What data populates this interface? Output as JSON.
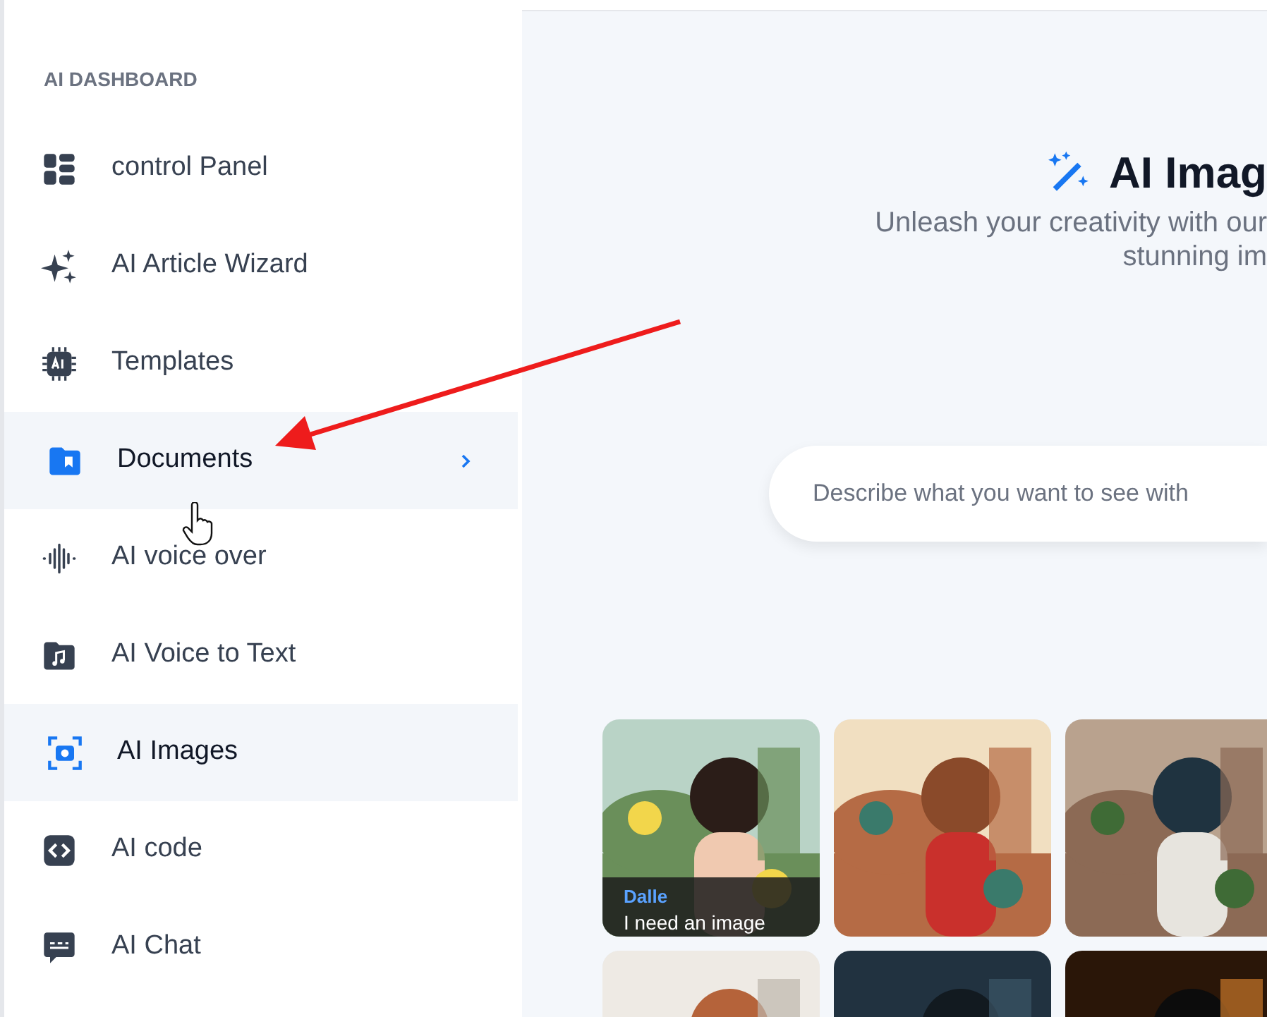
{
  "sidebar": {
    "heading": "AI DASHBOARD",
    "items": [
      {
        "label": "control Panel",
        "kind": "grid",
        "selected": false,
        "expandable": false
      },
      {
        "label": "AI Article Wizard",
        "kind": "sparkles",
        "selected": false,
        "expandable": false
      },
      {
        "label": "Templates",
        "kind": "chip",
        "selected": false,
        "expandable": false
      },
      {
        "label": "Documents",
        "kind": "folder",
        "selected": true,
        "expandable": true
      },
      {
        "label": "AI voice over",
        "kind": "wave",
        "selected": false,
        "expandable": false
      },
      {
        "label": "AI Voice to Text",
        "kind": "music",
        "selected": false,
        "expandable": false
      },
      {
        "label": "AI Images",
        "kind": "camera",
        "selected": true,
        "expandable": false
      },
      {
        "label": "AI code",
        "kind": "code",
        "selected": false,
        "expandable": false
      },
      {
        "label": "AI Chat",
        "kind": "chat",
        "selected": false,
        "expandable": false
      }
    ]
  },
  "main": {
    "title": "AI Imag",
    "subtitle": [
      "Unleash your creativity with our",
      "stunning im"
    ],
    "search": {
      "placeholder": "Describe what you want to see with"
    },
    "gallery": [
      {
        "kind": "picture",
        "model": "Dalle",
        "prompt": "I need an image"
      },
      {
        "kind": "picture"
      },
      {
        "kind": "picture"
      },
      {
        "kind": "picture"
      },
      {
        "kind": "picture"
      },
      {
        "kind": "picture"
      }
    ]
  }
}
